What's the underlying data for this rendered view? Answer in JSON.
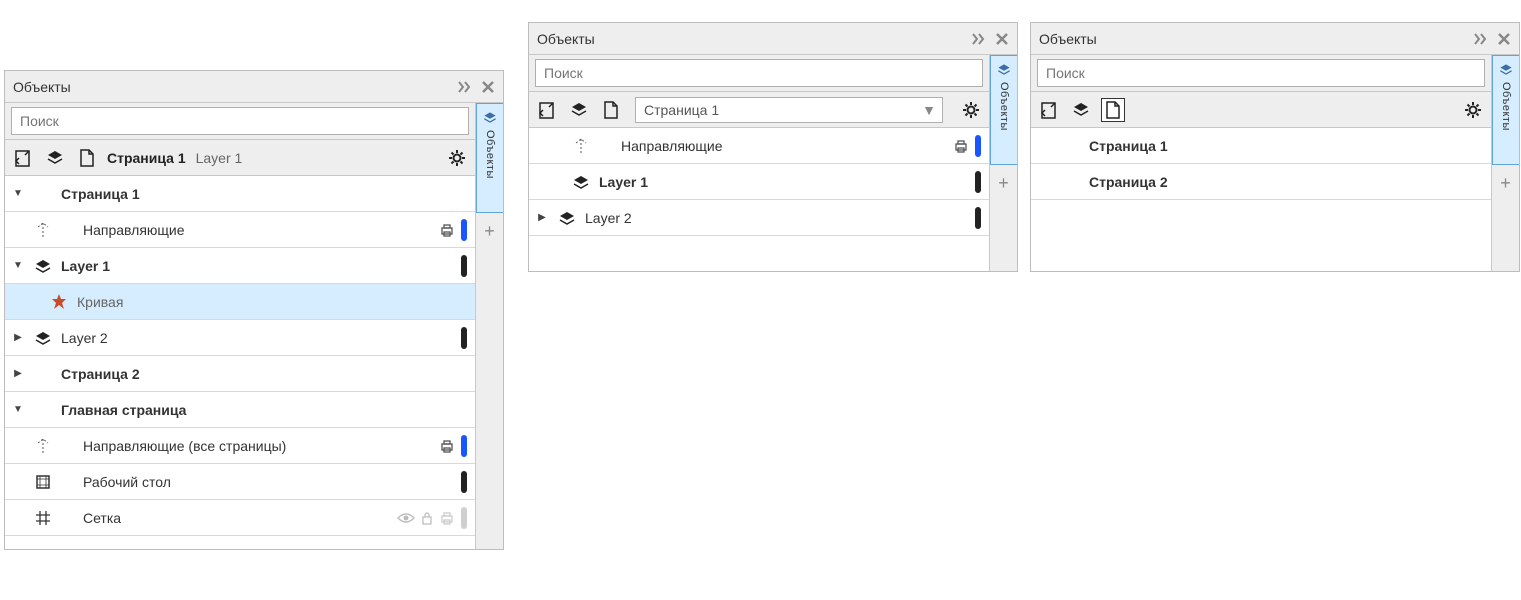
{
  "shared": {
    "panel_title": "Объекты",
    "search_placeholder": "Поиск",
    "side_tab_label": "Объекты"
  },
  "panel1": {
    "breadcrumb_page": "Страница 1",
    "breadcrumb_layer": "Layer 1",
    "tree": {
      "page1": "Страница 1",
      "guides": "Направляющие",
      "layer1": "Layer 1",
      "curve": "Кривая",
      "layer2": "Layer 2",
      "page2": "Страница 2",
      "master_page": "Главная страница",
      "guides_all": "Направляющие (все страницы)",
      "desktop": "Рабочий стол",
      "grid": "Сетка"
    }
  },
  "panel2": {
    "dropdown_value": "Страница 1",
    "tree": {
      "guides": "Направляющие",
      "layer1": "Layer 1",
      "layer2": "Layer 2"
    }
  },
  "panel3": {
    "tree": {
      "page1": "Страница 1",
      "page2": "Страница 2"
    }
  }
}
